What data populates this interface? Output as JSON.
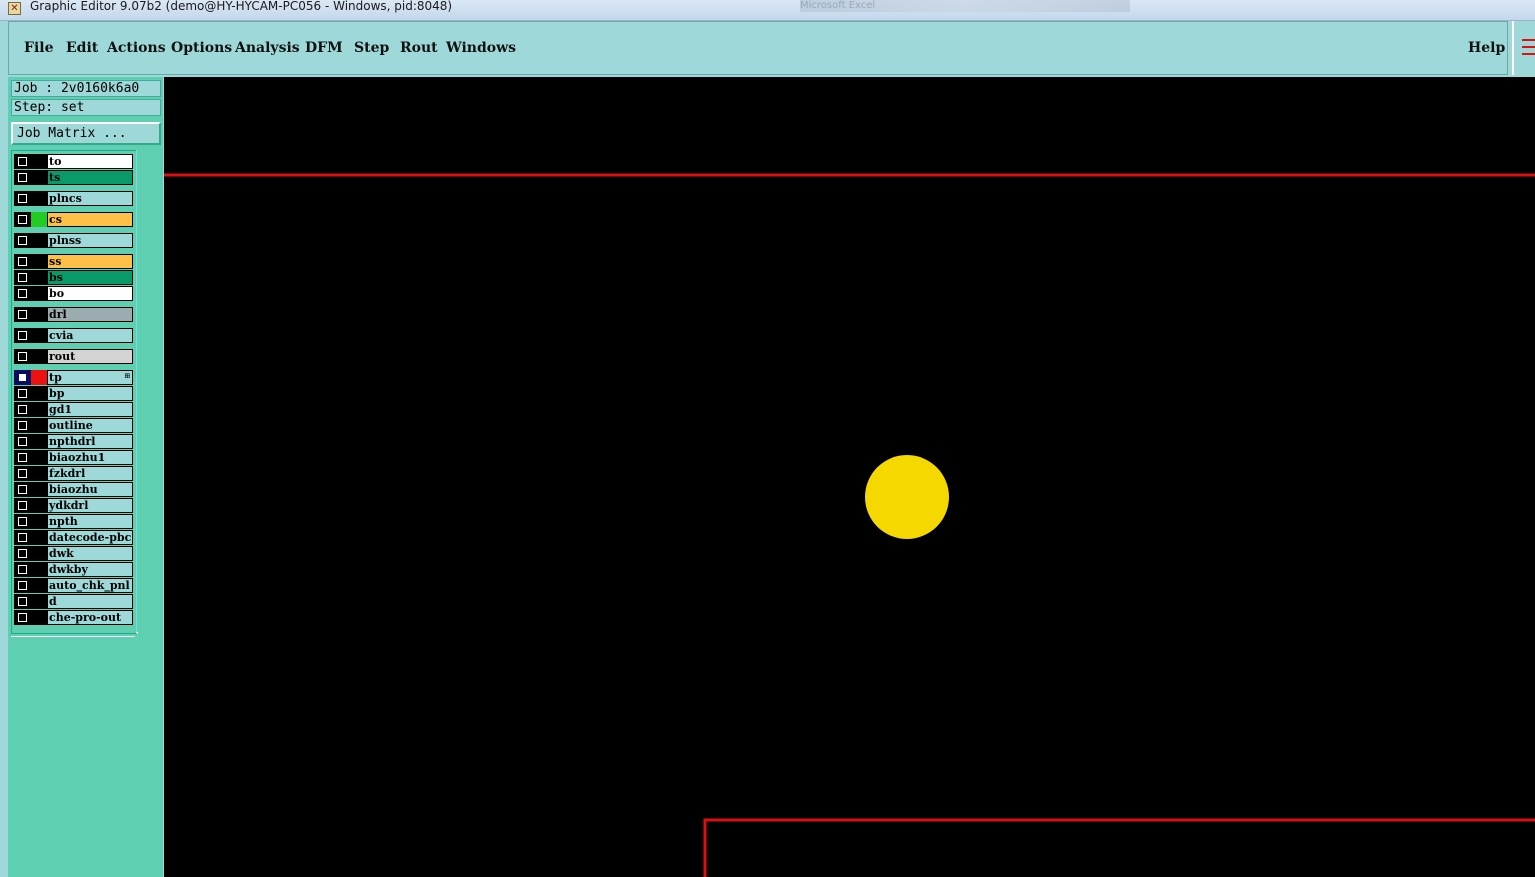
{
  "window": {
    "title": "Graphic Editor 9.07b2 (demo@HY-HYCAM-PC056 - Windows, pid:8048)",
    "background_app_title": "Microsoft Excel",
    "app_icon": "editor-app-icon"
  },
  "menu": {
    "file": "File",
    "edit": "Edit",
    "actions": "Actions",
    "options": "Options",
    "analysis": "Analysis",
    "dfm": "DFM",
    "step": "Step",
    "rout": "Rout",
    "windows": "Windows",
    "help": "Help"
  },
  "panel": {
    "job": "Job : 2v0160k6a0",
    "step": "Step: set",
    "job_matrix_label": "Job Matrix ..."
  },
  "layers": [
    {
      "name": "to",
      "bg": "#ffffff",
      "color": "#000000",
      "checked": false
    },
    {
      "name": "ts",
      "bg": "#0a9a6a",
      "color": "#000000",
      "checked": false
    },
    {
      "name": "plncs",
      "bg": "#9ed8d8",
      "color": "#000000",
      "checked": false
    },
    {
      "name": "cs",
      "bg": "#ffc04a",
      "color": "#22cc22",
      "checked": false
    },
    {
      "name": "plnss",
      "bg": "#9ed8d8",
      "color": "#000000",
      "checked": false
    },
    {
      "name": "ss",
      "bg": "#ffc04a",
      "color": "#000000",
      "checked": false
    },
    {
      "name": "bs",
      "bg": "#0a9a6a",
      "color": "#000000",
      "checked": false
    },
    {
      "name": "bo",
      "bg": "#ffffff",
      "color": "#000000",
      "checked": false
    },
    {
      "name": "drl",
      "bg": "#9aacb0",
      "color": "#000000",
      "checked": false
    },
    {
      "name": "cvia",
      "bg": "#9ed8d8",
      "color": "#000000",
      "checked": false
    },
    {
      "name": "rout",
      "bg": "#d4d4d4",
      "color": "#000000",
      "checked": false
    },
    {
      "name": "tp",
      "bg": "#9ed8d8",
      "color": "#ee1111",
      "checked": true,
      "flag": "⊞"
    },
    {
      "name": "bp",
      "bg": "#9ed8d8",
      "color": "#000000",
      "checked": false
    },
    {
      "name": "gd1",
      "bg": "#9ed8d8",
      "color": "#000000",
      "checked": false
    },
    {
      "name": "outline",
      "bg": "#9ed8d8",
      "color": "#000000",
      "checked": false
    },
    {
      "name": "npthdrl",
      "bg": "#9ed8d8",
      "color": "#000000",
      "checked": false
    },
    {
      "name": "biaozhu1",
      "bg": "#9ed8d8",
      "color": "#000000",
      "checked": false
    },
    {
      "name": "fzkdrl",
      "bg": "#9ed8d8",
      "color": "#000000",
      "checked": false
    },
    {
      "name": "biaozhu",
      "bg": "#9ed8d8",
      "color": "#000000",
      "checked": false
    },
    {
      "name": "ydkdrl",
      "bg": "#9ed8d8",
      "color": "#000000",
      "checked": false
    },
    {
      "name": "npth",
      "bg": "#9ed8d8",
      "color": "#000000",
      "checked": false
    },
    {
      "name": "datecode-pbc",
      "bg": "#9ed8d8",
      "color": "#000000",
      "checked": false
    },
    {
      "name": "dwk",
      "bg": "#9ed8d8",
      "color": "#000000",
      "checked": false
    },
    {
      "name": "dwkby",
      "bg": "#9ed8d8",
      "color": "#000000",
      "checked": false
    },
    {
      "name": "auto_chk_pnl",
      "bg": "#9ed8d8",
      "color": "#000000",
      "checked": false
    },
    {
      "name": "d",
      "bg": "#9ed8d8",
      "color": "#000000",
      "checked": false
    },
    {
      "name": "che-pro-out",
      "bg": "#9ed8d8",
      "color": "#000000",
      "checked": false
    }
  ],
  "canvas": {
    "background": "#000000",
    "outline_color": "#dd1010",
    "pad_color": "#f5d800"
  }
}
